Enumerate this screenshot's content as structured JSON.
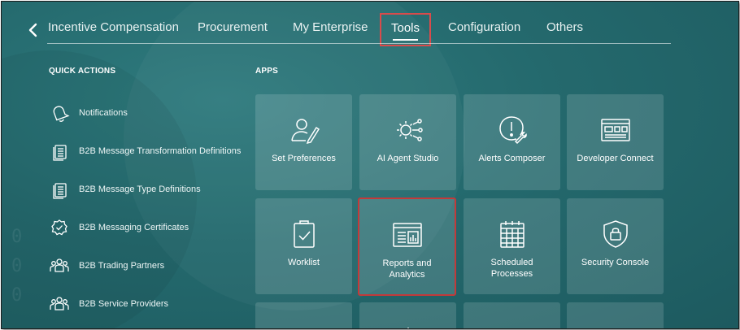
{
  "nav": {
    "tabs": [
      {
        "label": "Incentive Compensation"
      },
      {
        "label": "Procurement"
      },
      {
        "label": "My Enterprise"
      },
      {
        "label": "Tools"
      },
      {
        "label": "Configuration"
      },
      {
        "label": "Others"
      }
    ],
    "selected": "Tools"
  },
  "quick_actions": {
    "title": "QUICK ACTIONS",
    "items": [
      {
        "label": "Notifications",
        "icon": "bell-icon"
      },
      {
        "label": "B2B Message Transformation Definitions",
        "icon": "documents-icon"
      },
      {
        "label": "B2B Message Type Definitions",
        "icon": "documents-icon"
      },
      {
        "label": "B2B Messaging Certificates",
        "icon": "certificate-badge-icon"
      },
      {
        "label": "B2B Trading Partners",
        "icon": "group-icon"
      },
      {
        "label": "B2B Service Providers",
        "icon": "group-icon"
      }
    ]
  },
  "apps": {
    "title": "APPS",
    "tiles": [
      {
        "label": "Set Preferences",
        "icon": "person-pencil-icon"
      },
      {
        "label": "AI Agent Studio",
        "icon": "ai-gear-nodes-icon"
      },
      {
        "label": "Alerts Composer",
        "icon": "alert-wrench-icon"
      },
      {
        "label": "Developer Connect",
        "icon": "dashboard-window-icon"
      },
      {
        "label": "Worklist",
        "icon": "clipboard-check-icon"
      },
      {
        "label": "Reports and Analytics",
        "icon": "report-chart-icon"
      },
      {
        "label": "Scheduled Processes",
        "icon": "calendar-grid-icon"
      },
      {
        "label": "Security Console",
        "icon": "shield-lock-icon"
      }
    ]
  },
  "colors": {
    "background": "#24696d",
    "highlight": "#d94b4b",
    "text": "#ffffff"
  }
}
